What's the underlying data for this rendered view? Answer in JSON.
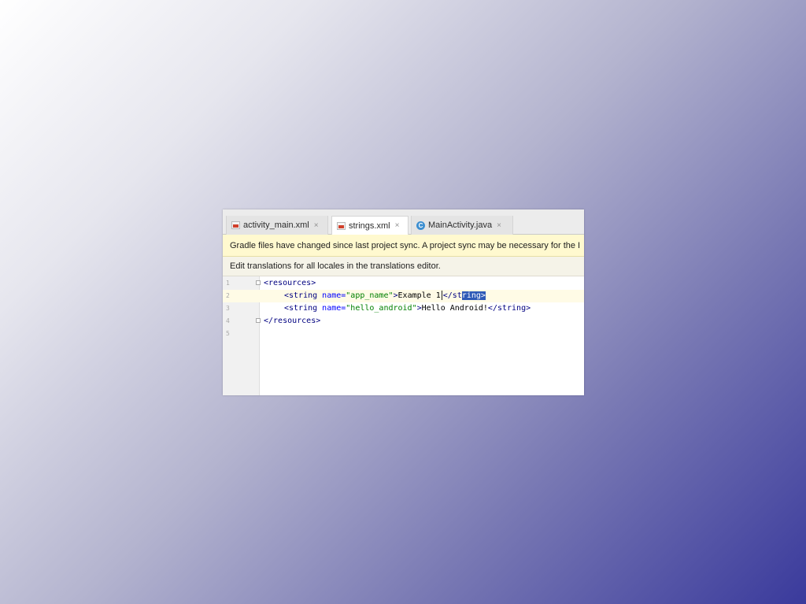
{
  "tabs": [
    {
      "label": "activity_main.xml",
      "icon": "xml-file-icon",
      "active": false
    },
    {
      "label": "strings.xml",
      "icon": "xml-file-icon",
      "active": true
    },
    {
      "label": "MainActivity.java",
      "icon": "class-icon",
      "active": false
    }
  ],
  "tab_close_glyph": "×",
  "class_icon_glyph": "C",
  "banners": {
    "gradle": "Gradle files have changed since last project sync. A project sync may be necessary for the I",
    "translations": "Edit translations for all locales in the translations editor."
  },
  "editor": {
    "line_numbers": [
      "1",
      "2",
      "3",
      "4",
      "5"
    ],
    "line1": {
      "open": "<resources>"
    },
    "line2": {
      "tag_open": "<string",
      "attr": " name=",
      "value": "\"app_name\"",
      "gt": ">",
      "text": "Example 1",
      "close_tag_start": "</st",
      "close_tag_selected": "ring>"
    },
    "line3": {
      "tag_open": "<string",
      "attr": " name=",
      "value": "\"hello_android\"",
      "gt": ">",
      "text": "Hello Android!",
      "close_tag": "</string>"
    },
    "line4": {
      "close": "</resources>"
    }
  },
  "colors": {
    "warning_banner": "#fff9cf",
    "selection": "#2f5bb7",
    "xml_tag": "#000080",
    "xml_value": "#008000"
  }
}
